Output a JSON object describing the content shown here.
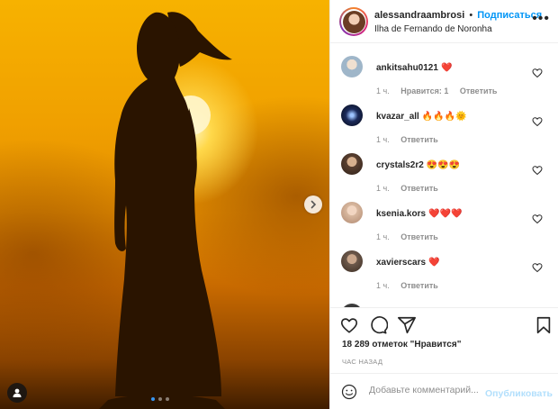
{
  "header": {
    "username": "alessandraambrosi",
    "separator": "•",
    "follow_label": "Подписаться",
    "location": "Ilha de Fernando de Noronha",
    "more_label": "•••"
  },
  "comments": [
    {
      "username": "ankitsahu0121",
      "emoji": "❤️",
      "time": "1 ч.",
      "likes_label": "Нравится: 1",
      "reply_label": "Ответить",
      "avatar_color": "#9fb6c9"
    },
    {
      "username": "kvazar_all",
      "emoji": "🔥🔥🔥🌞",
      "time": "1 ч.",
      "likes_label": "",
      "reply_label": "Ответить",
      "avatar_color": "#1b2a5a"
    },
    {
      "username": "crystals2r2",
      "emoji": "😍😍😍",
      "time": "1 ч.",
      "likes_label": "",
      "reply_label": "Ответить",
      "avatar_color": "#5a4030"
    },
    {
      "username": "ksenia.kors",
      "emoji": "❤️❤️❤️",
      "time": "1 ч.",
      "likes_label": "",
      "reply_label": "Ответить",
      "avatar_color": "#d9b9a0"
    },
    {
      "username": "xavierscars",
      "emoji": "❤️",
      "time": "1 ч.",
      "likes_label": "",
      "reply_label": "Ответить",
      "avatar_color": "#6e5a4c"
    }
  ],
  "likes_text": "18 289 отметок \"Нравится\"",
  "time_ago": "ЧАС НАЗАД",
  "comment_input": {
    "placeholder": "Добавьте комментарий...",
    "post_label": "Опубликовать"
  },
  "colors": {
    "accent": "#0095f6",
    "post_disabled": "#b2dffc",
    "muted": "#8e8e8e"
  },
  "icons": [
    "heart-icon",
    "comment-icon",
    "share-icon",
    "bookmark-icon",
    "smile-icon",
    "chevron-right-icon",
    "user-tag-icon",
    "more-icon"
  ]
}
